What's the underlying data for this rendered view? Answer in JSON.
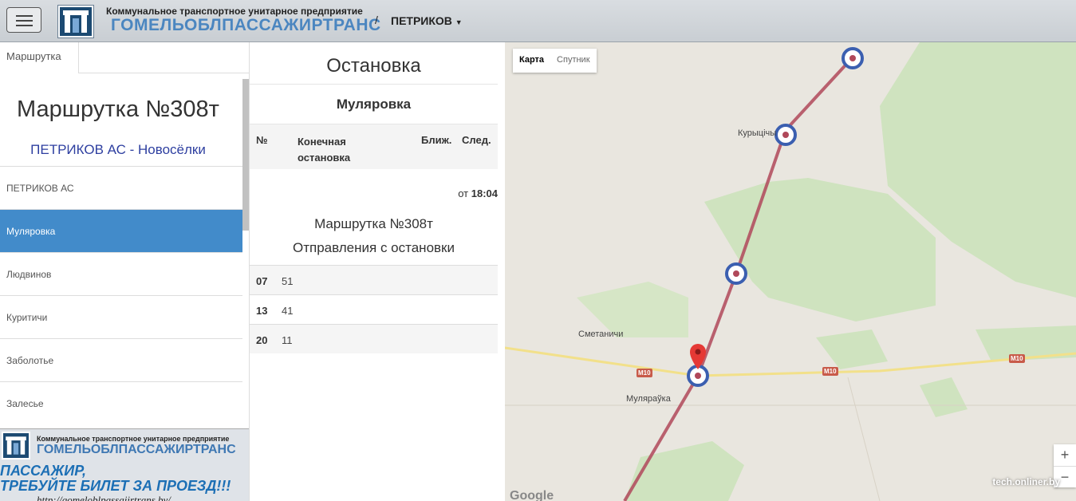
{
  "header": {
    "org_small": "Коммунальное транспортное унитарное предприятие",
    "org_big": "ГОМЕЛЬОБЛПАССАЖИРТРАНС",
    "crumb_sep": "/",
    "city": "ПЕТРИКОВ"
  },
  "left": {
    "tab": "Маршрутка",
    "route_title": "Маршрутка №308т",
    "dir_from": "ПЕТРИКОВ АС",
    "dir_sep": " - ",
    "dir_to": "Новосёлки",
    "stops": [
      "ПЕТРИКОВ АС",
      "Муляровка",
      "Людвинов",
      "Куритичи",
      "Заболотье",
      "Залесье"
    ],
    "active_stop_index": 1
  },
  "banner": {
    "small": "Коммунальное транспортное унитарное предприятие",
    "big": "ГОМЕЛЬОБЛПАССАЖИРТРАНС",
    "slogan1": "ПАССАЖИР,",
    "slogan2": "ТРЕБУЙТЕ БИЛЕТ ЗА ПРОЕЗД!!!",
    "url": "http://gomeloblpassajirtrans.by/"
  },
  "mid": {
    "heading": "Остановка",
    "stop_name": "Муляровка",
    "col_num": "№",
    "col_end_1": "Конечная",
    "col_end_2": "остановка",
    "col_near": "Ближ.",
    "col_next": "След.",
    "from_label": "от",
    "from_time": "18:04",
    "dep_line1": "Маршрутка №308т",
    "dep_line2": "Отправления с остановки",
    "times": [
      {
        "hour": "07",
        "minutes": "51"
      },
      {
        "hour": "13",
        "minutes": "41"
      },
      {
        "hour": "20",
        "minutes": "11"
      }
    ]
  },
  "map": {
    "btn_map": "Карта",
    "btn_sat": "Спутник",
    "labels": {
      "kurytsichy": "Курыцічы",
      "smetanichi": "Сметаничи",
      "mulyarayka": "Муляраўка"
    },
    "road": "M10",
    "zoom_in": "+",
    "zoom_out": "−",
    "google": "Google",
    "watermark": "tech.onliner.by",
    "colors": {
      "route": "#b0485a",
      "stop_ring": "#3b5fb0",
      "forest": "#cfe3bf",
      "road": "#f2e08a"
    }
  }
}
